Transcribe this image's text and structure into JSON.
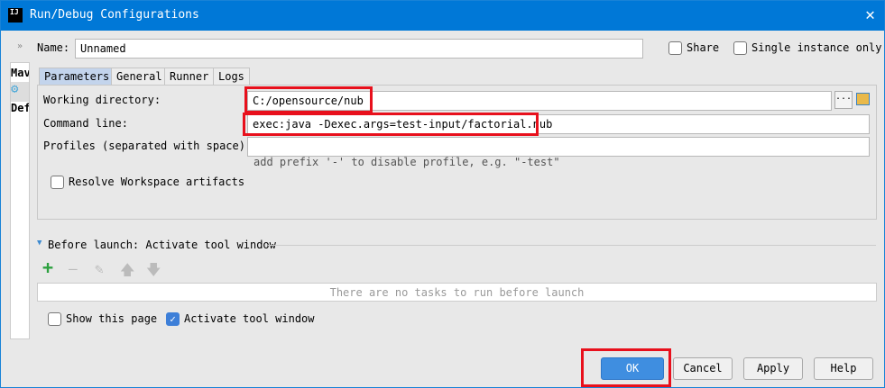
{
  "window": {
    "title": "Run/Debug Configurations",
    "logo": "IJ"
  },
  "name_label": "Name:",
  "name_value": "Unnamed",
  "share_label": "Share",
  "single_instance_label": "Single instance only",
  "sidebar": {
    "items": [
      "Mav",
      "Def"
    ]
  },
  "tabs": [
    "Parameters",
    "General",
    "Runner",
    "Logs"
  ],
  "params": {
    "working_dir_label": "Working directory:",
    "working_dir_value": "C:/opensource/nub",
    "command_line_label": "Command line:",
    "command_line_value": "exec:java -Dexec.args=test-input/factorial.nub",
    "profiles_label": "Profiles (separated with space):",
    "profiles_value": "",
    "profiles_hint": "add prefix '-' to disable profile, e.g. \"-test\"",
    "resolve_label": "Resolve Workspace artifacts",
    "browse_label": "..."
  },
  "before_launch": {
    "title": "Before launch: Activate tool window",
    "empty_text": "There are no tasks to run before launch"
  },
  "show_page_label": "Show this page",
  "activate_label": "Activate tool window",
  "buttons": {
    "ok": "OK",
    "cancel": "Cancel",
    "apply": "Apply",
    "help": "Help"
  },
  "colors": {
    "titlebar": "#0078d7",
    "highlight": "#e8101c"
  }
}
